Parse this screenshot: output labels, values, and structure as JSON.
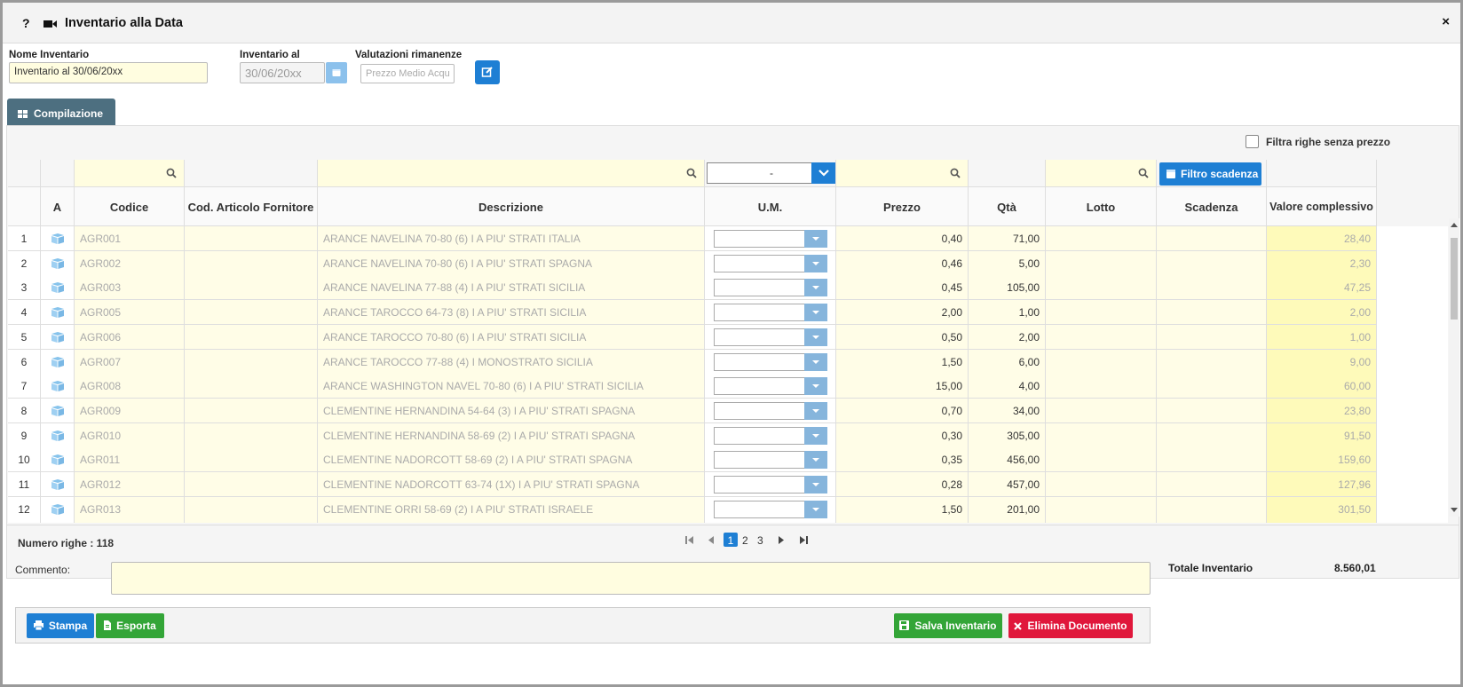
{
  "window": {
    "title": "Inventario alla Data",
    "help_label": "?",
    "close_label": "×"
  },
  "form": {
    "nome_label": "Nome Inventario",
    "nome_value": "Inventario al 30/06/20xx",
    "data_label": "Inventario al",
    "data_value": "30/06/20xx",
    "valutazioni_label": "Valutazioni rimanenze",
    "valutazioni_placeholder": "Prezzo Medio Acqu"
  },
  "tab": {
    "label": "Compilazione"
  },
  "filter": {
    "senza_prezzo_label": "Filtra righe senza prezzo",
    "um_selected": "-",
    "scadenza_button": "Filtro scadenza"
  },
  "columns": [
    "",
    "A",
    "Codice",
    "Cod. Articolo Fornitore",
    "Descrizione",
    "U.M.",
    "Prezzo",
    "Qtà",
    "Lotto",
    "Scadenza",
    "Valore complessivo"
  ],
  "rows": [
    {
      "n": "1",
      "codice": "AGR001",
      "descrizione": "ARANCE NAVELINA 70-80 (6) I A PIU' STRATI     ITALIA",
      "prezzo": "0,40",
      "qta": "71,00",
      "valore": "28,40"
    },
    {
      "n": "2",
      "codice": "AGR002",
      "descrizione": "ARANCE NAVELINA 70-80 (6) I A PIU' STRATI     SPAGNA",
      "prezzo": "0,46",
      "qta": "5,00",
      "valore": "2,30"
    },
    {
      "n": "3",
      "codice": "AGR003",
      "descrizione": "ARANCE NAVELINA 77-88 (4) I A PIU' STRATI     SICILIA",
      "prezzo": "0,45",
      "qta": "105,00",
      "valore": "47,25"
    },
    {
      "n": "4",
      "codice": "AGR005",
      "descrizione": "ARANCE TAROCCO 64-73 (8) I A PIU' STRATI     SICILIA",
      "prezzo": "2,00",
      "qta": "1,00",
      "valore": "2,00"
    },
    {
      "n": "5",
      "codice": "AGR006",
      "descrizione": "ARANCE TAROCCO 70-80 (6) I A PIU' STRATI     SICILIA",
      "prezzo": "0,50",
      "qta": "2,00",
      "valore": "1,00"
    },
    {
      "n": "6",
      "codice": "AGR007",
      "descrizione": "ARANCE TAROCCO 77-88 (4) I MONOSTRATO     SICILIA",
      "prezzo": "1,50",
      "qta": "6,00",
      "valore": "9,00"
    },
    {
      "n": "7",
      "codice": "AGR008",
      "descrizione": "ARANCE WASHINGTON NAVEL 70-80 (6) I A PIU' STRATI     SICILIA",
      "prezzo": "15,00",
      "qta": "4,00",
      "valore": "60,00"
    },
    {
      "n": "8",
      "codice": "AGR009",
      "descrizione": "CLEMENTINE HERNANDINA 54-64 (3) I A PIU' STRATI     SPAGNA",
      "prezzo": "0,70",
      "qta": "34,00",
      "valore": "23,80"
    },
    {
      "n": "9",
      "codice": "AGR010",
      "descrizione": "CLEMENTINE HERNANDINA 58-69 (2) I A PIU' STRATI     SPAGNA",
      "prezzo": "0,30",
      "qta": "305,00",
      "valore": "91,50"
    },
    {
      "n": "10",
      "codice": "AGR011",
      "descrizione": "CLEMENTINE NADORCOTT 58-69 (2) I A PIU' STRATI     SPAGNA",
      "prezzo": "0,35",
      "qta": "456,00",
      "valore": "159,60"
    },
    {
      "n": "11",
      "codice": "AGR012",
      "descrizione": "CLEMENTINE NADORCOTT 63-74 (1X) I A PIU' STRATI     SPAGNA",
      "prezzo": "0,28",
      "qta": "457,00",
      "valore": "127,96"
    },
    {
      "n": "12",
      "codice": "AGR013",
      "descrizione": "CLEMENTINE ORRI 58-69 (2) I A PIU' STRATI     ISRAELE",
      "prezzo": "1,50",
      "qta": "201,00",
      "valore": "301,50"
    }
  ],
  "footer": {
    "numero_righe": "Numero righe : 118",
    "pages": [
      "1",
      "2",
      "3"
    ],
    "current_page": "1"
  },
  "commento_label": "Commento:",
  "totale": {
    "label": "Totale Inventario",
    "value": "8.560,01"
  },
  "buttons": {
    "stampa": "Stampa",
    "esporta": "Esporta",
    "salva": "Salva Inventario",
    "elimina": "Elimina Documento"
  },
  "colors": {
    "primary": "#1e7fd4",
    "success": "#33a537",
    "danger": "#e0173b",
    "tab": "#4d6f80",
    "input_yellow": "#fffde0"
  },
  "icons": [
    "help-icon",
    "video-camera-icon",
    "close-icon",
    "calendar-icon",
    "edit-icon",
    "table-icon",
    "search-icon",
    "chevron-down-icon",
    "box-icon",
    "print-icon",
    "file-icon",
    "save-icon",
    "delete-icon"
  ]
}
